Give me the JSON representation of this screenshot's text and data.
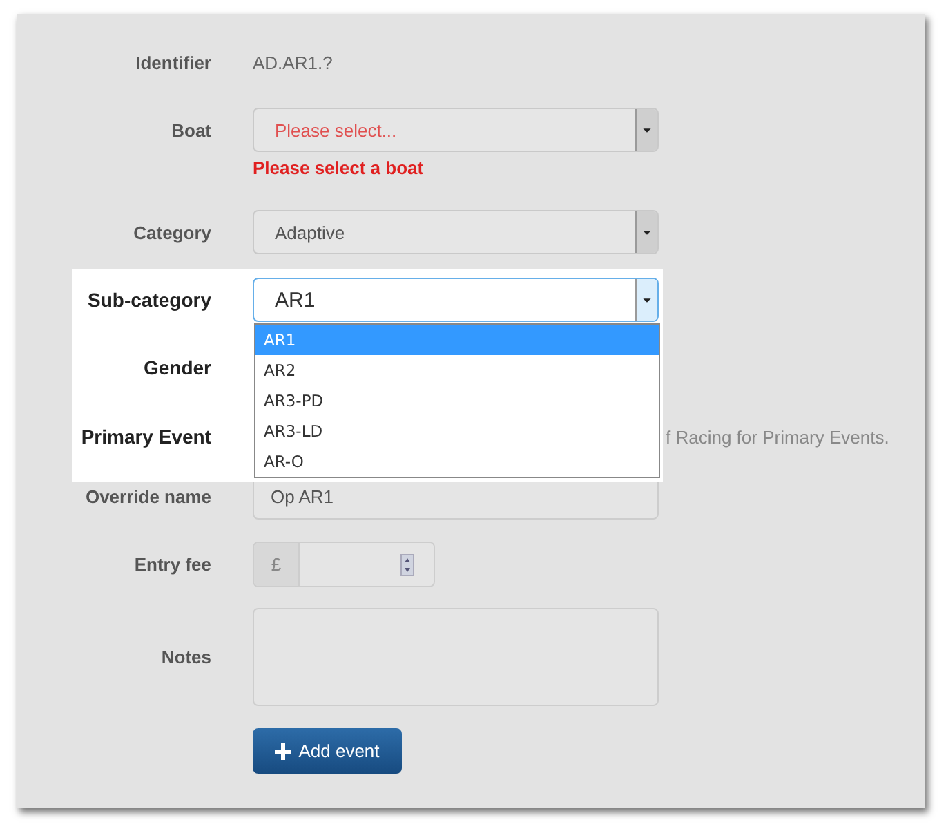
{
  "form": {
    "fields": [
      {
        "kind": "text",
        "label": "Identifier",
        "value": "AD.AR1.?",
        "focused": false
      },
      {
        "kind": "select",
        "label": "Boat",
        "value": "Please select...",
        "error": "Please select a boat",
        "focused": false
      },
      {
        "kind": "select",
        "label": "Category",
        "value": "Adaptive",
        "focused": false
      },
      {
        "kind": "select",
        "label": "Sub-category",
        "value": "AR1",
        "focused": true,
        "expanded": true,
        "options": [
          {
            "label": "AR1",
            "selected": true
          },
          {
            "label": "AR2",
            "selected": false
          },
          {
            "label": "AR3-PD",
            "selected": false
          },
          {
            "label": "AR3-LD",
            "selected": false
          },
          {
            "label": "AR-O",
            "selected": false
          }
        ]
      },
      {
        "kind": "covered",
        "label": "Gender",
        "focused": true
      },
      {
        "kind": "covered",
        "label": "Primary Event",
        "help": "f Racing for Primary Events.",
        "focused": true
      },
      {
        "kind": "input",
        "label": "Override name",
        "value": "Op AR1",
        "focused": false
      },
      {
        "kind": "currency",
        "label": "Entry fee",
        "prefix": "£",
        "focused": false
      },
      {
        "kind": "textarea",
        "label": "Notes",
        "focused": false
      }
    ]
  },
  "button": {
    "label": "Add event"
  }
}
